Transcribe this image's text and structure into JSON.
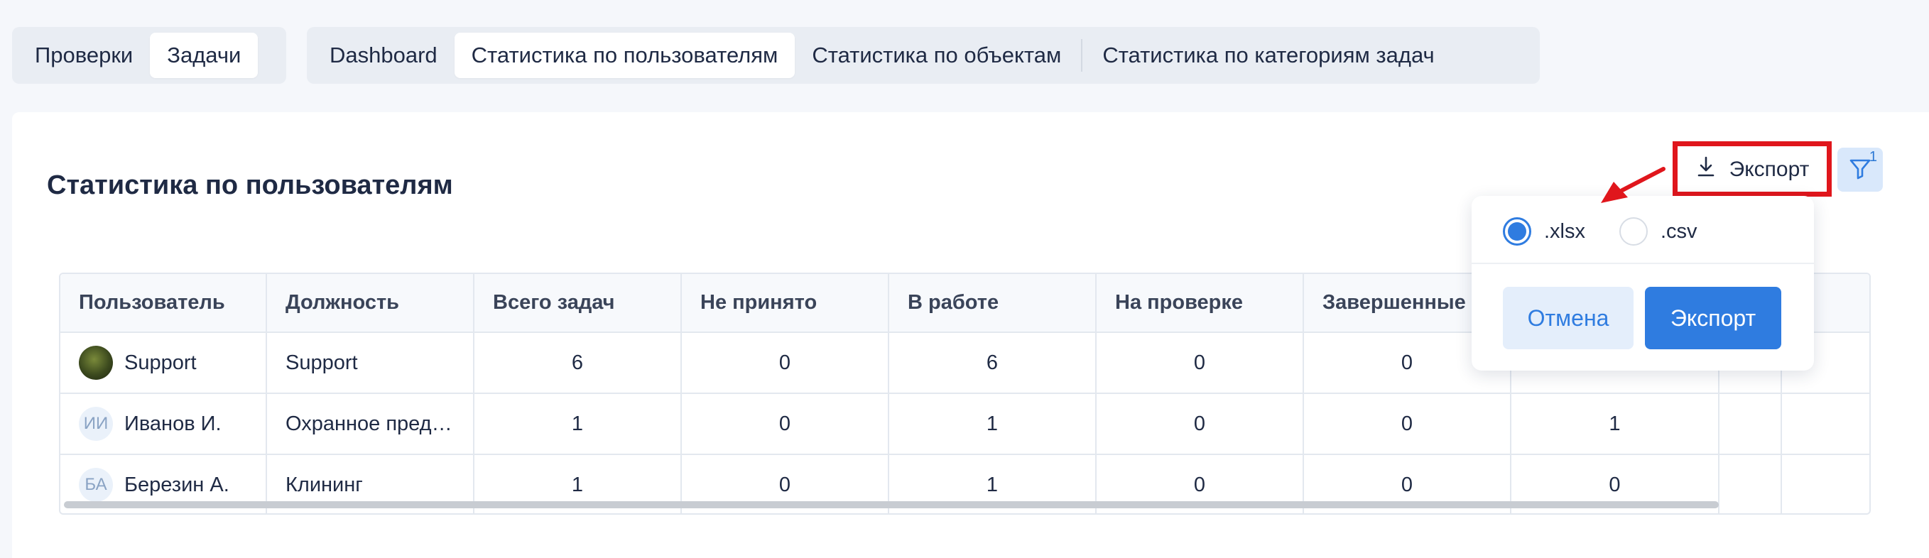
{
  "top_tabs_left": [
    {
      "label": "Проверки",
      "active": false
    },
    {
      "label": "Задачи",
      "active": true
    }
  ],
  "top_tabs_right": [
    {
      "label": "Dashboard",
      "active": false
    },
    {
      "label": "Статистика по пользователям",
      "active": true
    },
    {
      "label": "Статистика по объектам",
      "active": false
    },
    {
      "label": "Статистика по категориям задач",
      "active": false
    }
  ],
  "page": {
    "title": "Статистика по пользователям"
  },
  "toolbar": {
    "export_label": "Экспорт",
    "filter_count": "1"
  },
  "table": {
    "columns": [
      "Пользователь",
      "Должность",
      "Всего задач",
      "Не принято",
      "В работе",
      "На проверке",
      "Завершенные",
      "",
      "",
      ""
    ],
    "rows": [
      {
        "avatar": "",
        "user": "Support",
        "position": "Support",
        "values": [
          "6",
          "0",
          "6",
          "0",
          "0",
          "",
          "",
          ""
        ]
      },
      {
        "avatar": "ИИ",
        "user": "Иванов И.",
        "position": "Охранное предп...",
        "values": [
          "1",
          "0",
          "1",
          "0",
          "0",
          "1",
          "",
          ""
        ]
      },
      {
        "avatar": "БА",
        "user": "Березин А.",
        "position": "Клининг",
        "values": [
          "1",
          "0",
          "1",
          "0",
          "0",
          "0",
          "",
          ""
        ]
      }
    ]
  },
  "export_popover": {
    "formats": [
      {
        "label": ".xlsx",
        "selected": true
      },
      {
        "label": ".csv",
        "selected": false
      }
    ],
    "cancel_label": "Отмена",
    "export_label": "Экспорт"
  },
  "colors": {
    "accent": "#2f7ce0",
    "highlight": "#e0161c"
  }
}
